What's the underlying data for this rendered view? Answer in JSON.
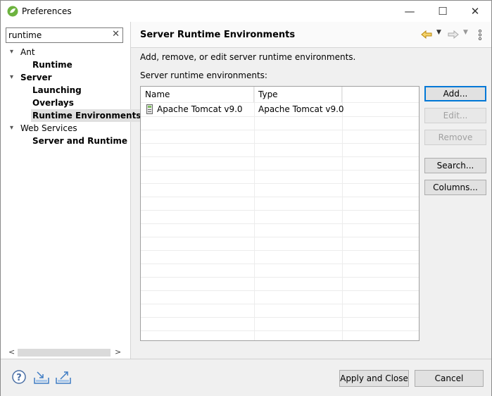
{
  "window": {
    "title": "Preferences",
    "minimize_glyph": "—",
    "maximize_glyph": "☐",
    "close_glyph": "✕"
  },
  "filter": {
    "value": "runtime",
    "clear_glyph": "✕"
  },
  "tree": {
    "items": [
      {
        "label": "Ant",
        "expanded": true
      },
      {
        "label": "Runtime"
      },
      {
        "label": "Server",
        "expanded": true
      },
      {
        "label": "Launching"
      },
      {
        "label": "Overlays"
      },
      {
        "label": "Runtime Environments",
        "selected": true
      },
      {
        "label": "Web Services",
        "expanded": true
      },
      {
        "label": "Server and Runtime"
      }
    ]
  },
  "page": {
    "title": "Server Runtime Environments",
    "description": "Add, remove, or edit server runtime environments.",
    "table_label": "Server runtime environments:",
    "table": {
      "columns": [
        "Name",
        "Type"
      ],
      "rows": [
        {
          "name": "Apache Tomcat v9.0",
          "type": "Apache Tomcat v9.0"
        }
      ]
    }
  },
  "buttons": {
    "add": "Add...",
    "edit": "Edit...",
    "remove": "Remove",
    "search": "Search...",
    "columns": "Columns..."
  },
  "footer": {
    "apply_close": "Apply and Close",
    "cancel": "Cancel"
  },
  "colors": {
    "accent": "#0078d7",
    "spring_green": "#6db33f"
  }
}
